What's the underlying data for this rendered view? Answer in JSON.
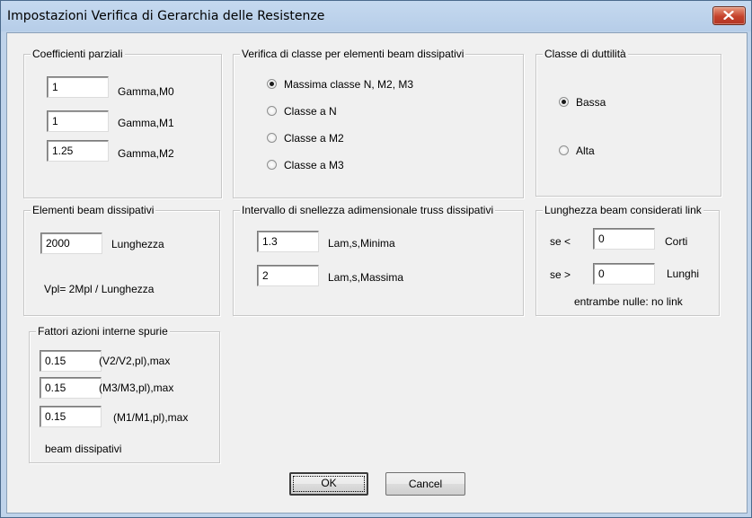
{
  "window": {
    "title": "Impostazioni Verifica di Gerarchia delle Resistenze"
  },
  "coefficienti": {
    "legend": "Coefficienti parziali",
    "rows": [
      {
        "value": "1",
        "label": "Gamma,M0"
      },
      {
        "value": "1",
        "label": "Gamma,M1"
      },
      {
        "value": "1.25",
        "label": "Gamma,M2"
      }
    ]
  },
  "verifica_classe": {
    "legend": "Verifica di classe per elementi beam dissipativi",
    "options": [
      {
        "label": "Massima classe N, M2, M3",
        "checked": true
      },
      {
        "label": "Classe a N",
        "checked": false
      },
      {
        "label": "Classe a M2",
        "checked": false
      },
      {
        "label": "Classe a M3",
        "checked": false
      }
    ]
  },
  "duttilita": {
    "legend": "Classe di duttilità",
    "options": [
      {
        "label": "Bassa",
        "checked": true
      },
      {
        "label": "Alta",
        "checked": false
      }
    ]
  },
  "beam_dissipativi": {
    "legend": "Elementi beam dissipativi",
    "value": "2000",
    "label": "Lunghezza",
    "formula": "Vpl= 2Mpl / Lunghezza"
  },
  "snellezza": {
    "legend": "Intervallo di snellezza adimensionale truss dissipativi",
    "rows": [
      {
        "value": "1.3",
        "label": "Lam,s,Minima"
      },
      {
        "value": "2",
        "label": "Lam,s,Massima"
      }
    ]
  },
  "link": {
    "legend": "Lunghezza beam considerati link",
    "rows": [
      {
        "prefix": "se <",
        "value": "0",
        "label": "Corti"
      },
      {
        "prefix": "se >",
        "value": "0",
        "label": "Lunghi"
      }
    ],
    "note": "entrambe nulle: no link"
  },
  "fattori": {
    "legend": "Fattori azioni interne spurie",
    "rows": [
      {
        "value": "0.15",
        "label": "(V2/V2,pl),max"
      },
      {
        "value": "0.15",
        "label": "(M3/M3,pl),max"
      },
      {
        "value": "0.15",
        "label": "(M1/M1,pl),max"
      }
    ],
    "note": "beam dissipativi"
  },
  "buttons": {
    "ok": "OK",
    "cancel": "Cancel"
  }
}
